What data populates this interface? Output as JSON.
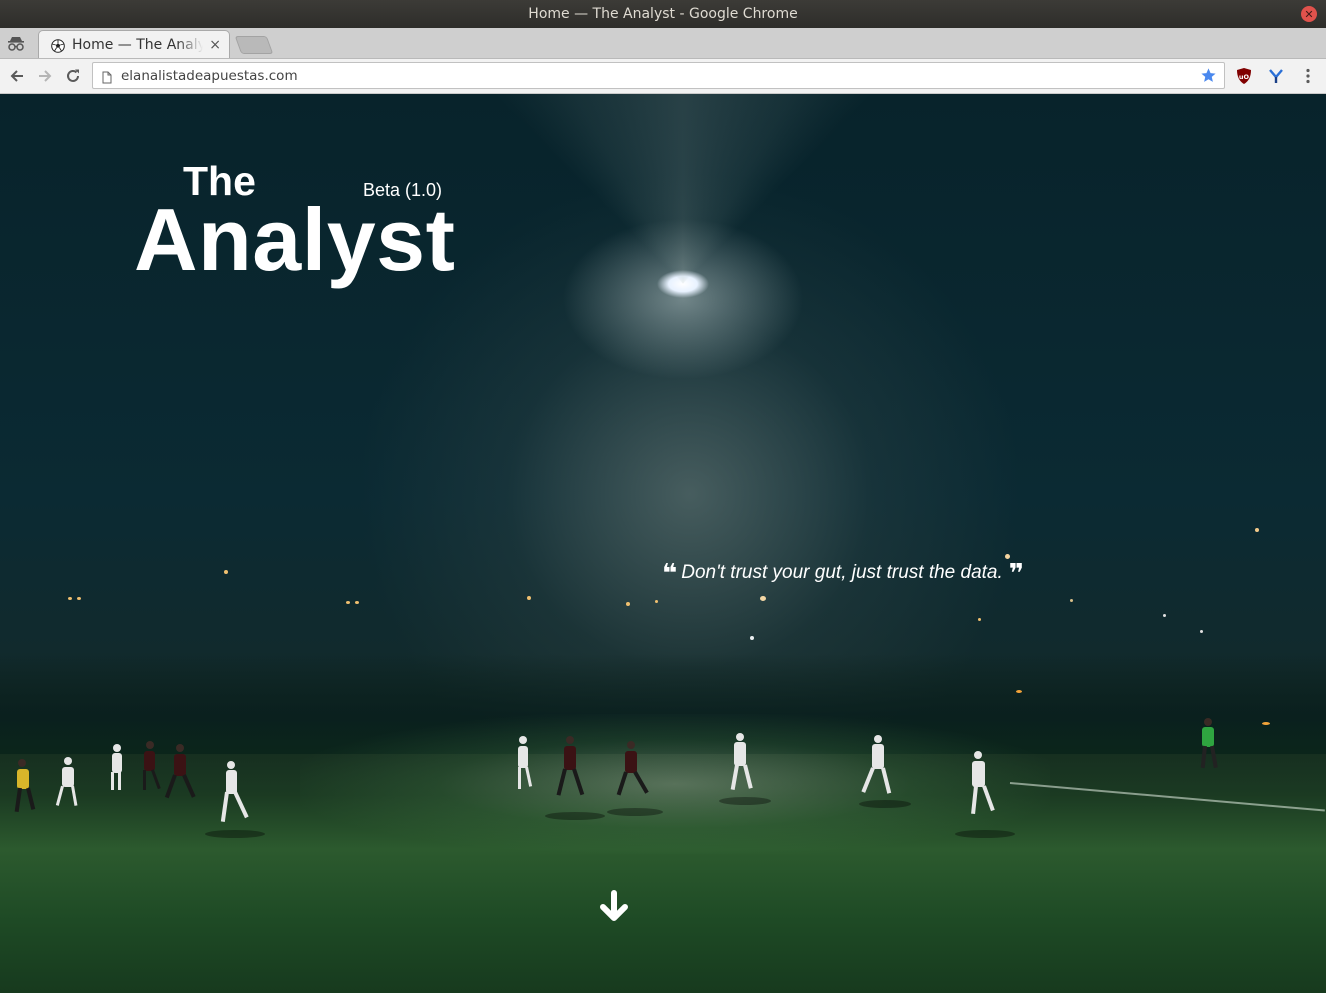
{
  "window": {
    "title": "Home — The Analyst - Google Chrome",
    "close_glyph": "✕"
  },
  "tabs": [
    {
      "title": "Home — The Analyst",
      "favicon": "soccer-ball-icon",
      "close_glyph": "×"
    }
  ],
  "toolbar": {
    "url": "elanalistadeapuestas.com",
    "icons": [
      "back-arrow-icon",
      "forward-arrow-icon",
      "reload-icon",
      "page-icon",
      "bookmark-star-icon",
      "ublock-icon",
      "extension-y-icon",
      "menu-kebab-icon"
    ]
  },
  "hero": {
    "brand_the": "The",
    "brand_analyst": "Analyst",
    "beta_label": "Beta (1.0)",
    "quote_open": "❝",
    "quote_text": "Don't trust your gut, just trust the data.",
    "quote_close": "❞",
    "scroll_icon": "down-arrow-icon"
  },
  "colors": {
    "titlebar": "#3c3b37",
    "tabstrip": "#cfcfcf",
    "toolbar": "#f2f2f2",
    "star_blue": "#4a88ee",
    "ublock_red": "#800000",
    "hero_text": "#ffffff"
  }
}
